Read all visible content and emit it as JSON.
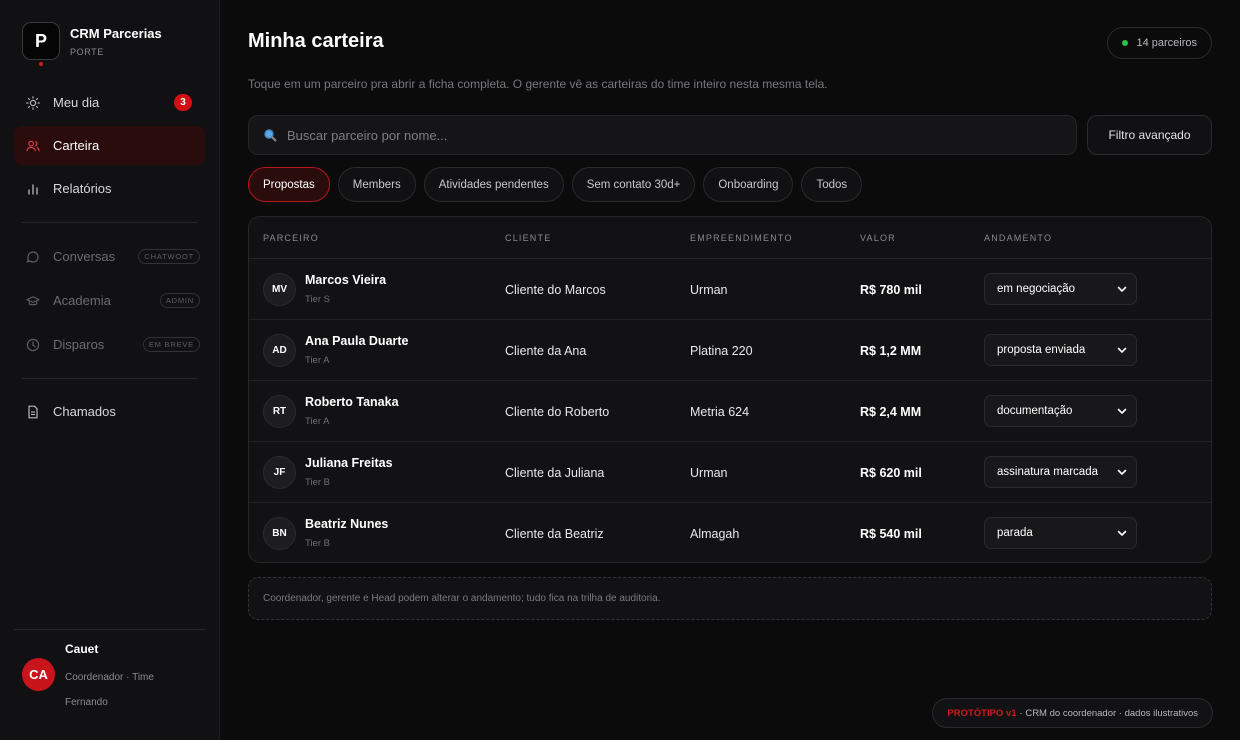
{
  "brand": {
    "logo_letter": "P",
    "title": "CRM Parcerias",
    "subtitle": "PORTE"
  },
  "nav": {
    "items": [
      {
        "label": "Meu dia",
        "icon": "sun-icon",
        "badge": "3"
      },
      {
        "label": "Carteira",
        "icon": "users-icon",
        "active": true
      },
      {
        "label": "Relatórios",
        "icon": "bar-chart-icon"
      }
    ],
    "muted_items": [
      {
        "label": "Conversas",
        "icon": "chat-icon",
        "tag": "CHATWOOT"
      },
      {
        "label": "Academia",
        "icon": "graduation-cap-icon",
        "tag": "ADMIN"
      },
      {
        "label": "Disparos",
        "icon": "clock-icon",
        "tag": "EM BREVE"
      }
    ],
    "bottom_items": [
      {
        "label": "Chamados",
        "icon": "document-icon"
      }
    ]
  },
  "user": {
    "initials": "CA",
    "name": "Cauet",
    "role": "Coordenador · Time Fernando"
  },
  "header": {
    "title": "Minha carteira",
    "count_label": "14 parceiros",
    "subtitle": "Toque em um parceiro pra abrir a ficha completa. O gerente vê as carteiras do time inteiro nesta mesma tela."
  },
  "search": {
    "placeholder": "Buscar parceiro por nome...",
    "value": ""
  },
  "filter_button": "Filtro avançado",
  "tabs": [
    {
      "label": "Propostas",
      "active": true
    },
    {
      "label": "Members"
    },
    {
      "label": "Atividades pendentes"
    },
    {
      "label": "Sem contato 30d+"
    },
    {
      "label": "Onboarding"
    },
    {
      "label": "Todos"
    }
  ],
  "table": {
    "columns": [
      "PARCEIRO",
      "CLIENTE",
      "EMPREENDIMENTO",
      "VALOR",
      "ANDAMENTO"
    ],
    "rows": [
      {
        "initials": "MV",
        "name": "Marcos Vieira",
        "tier": "Tier S",
        "client": "Cliente do Marcos",
        "project": "Urman",
        "value": "R$ 780 mil",
        "status": "em negociação"
      },
      {
        "initials": "AD",
        "name": "Ana Paula Duarte",
        "tier": "Tier A",
        "client": "Cliente da Ana",
        "project": "Platina 220",
        "value": "R$ 1,2 MM",
        "status": "proposta enviada"
      },
      {
        "initials": "RT",
        "name": "Roberto Tanaka",
        "tier": "Tier A",
        "client": "Cliente do Roberto",
        "project": "Metria 624",
        "value": "R$ 2,4 MM",
        "status": "documentação"
      },
      {
        "initials": "JF",
        "name": "Juliana Freitas",
        "tier": "Tier B",
        "client": "Cliente da Juliana",
        "project": "Urman",
        "value": "R$ 620 mil",
        "status": "assinatura marcada"
      },
      {
        "initials": "BN",
        "name": "Beatriz Nunes",
        "tier": "Tier B",
        "client": "Cliente da Beatriz",
        "project": "Almagah",
        "value": "R$ 540 mil",
        "status": "parada"
      }
    ]
  },
  "note": "Coordenador, gerente e Head podem alterar o andamento; tudo fica na trilha de auditoria.",
  "footer": {
    "strong": "PROTÓTIPO v1",
    "text": "· CRM do coordenador · dados ilustrativos"
  },
  "colors": {
    "accent": "#d11a1a",
    "active_bg": "#2a0c0d",
    "online": "#2fbf4a",
    "background": "#0b0b0c"
  }
}
